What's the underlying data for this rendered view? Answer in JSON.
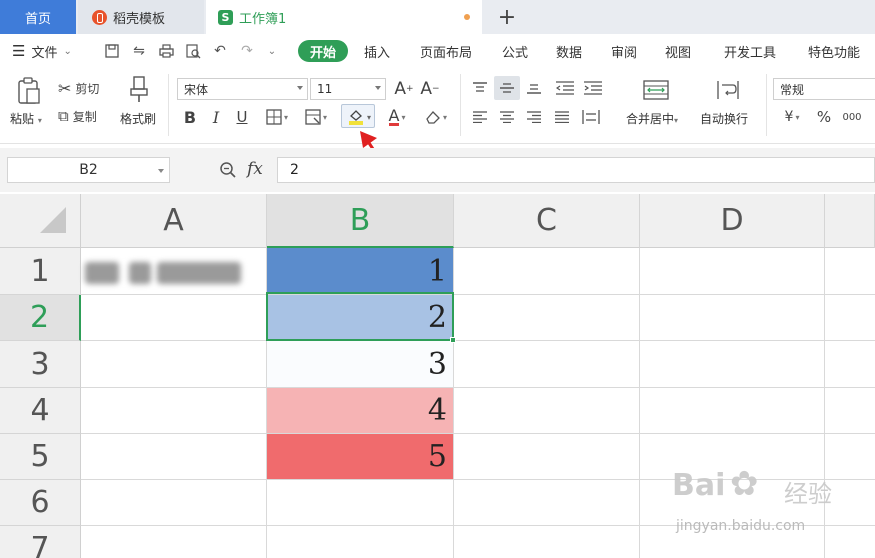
{
  "tabs": [
    {
      "label": "首页"
    },
    {
      "label": "稻壳模板"
    },
    {
      "label": "工作簿1"
    }
  ],
  "new_tab": "+",
  "menu": {
    "file": "文件",
    "items": [
      "开始",
      "插入",
      "页面布局",
      "公式",
      "数据",
      "审阅",
      "视图",
      "开发工具",
      "特色功能"
    ]
  },
  "ribbon": {
    "paste": "粘贴",
    "cut": "剪切",
    "copy": "复制",
    "format_painter": "格式刷",
    "font_name": "宋体",
    "font_size": "11",
    "merge_center": "合并居中",
    "auto_wrap": "自动换行",
    "number_format": "常规",
    "currency": "¥",
    "percent": "%",
    "thousands": "000"
  },
  "formula_bar": {
    "name_box": "B2",
    "fx": "fx",
    "value": "2"
  },
  "sheet": {
    "columns": [
      "A",
      "B",
      "C",
      "D"
    ],
    "rows": [
      "1",
      "2",
      "3",
      "4",
      "5",
      "6",
      "7"
    ],
    "b_values": [
      "1",
      "2",
      "3",
      "4",
      "5"
    ],
    "b_fill_colors": [
      "#5b8ccc",
      "#a8c2e4",
      "#fafcfe",
      "#f6b3b4",
      "#f06b6d"
    ],
    "selected_cell": "B2"
  },
  "watermark": {
    "logo": "Bai",
    "logo_cn": "经验",
    "url": "jingyan.baidu.com"
  }
}
